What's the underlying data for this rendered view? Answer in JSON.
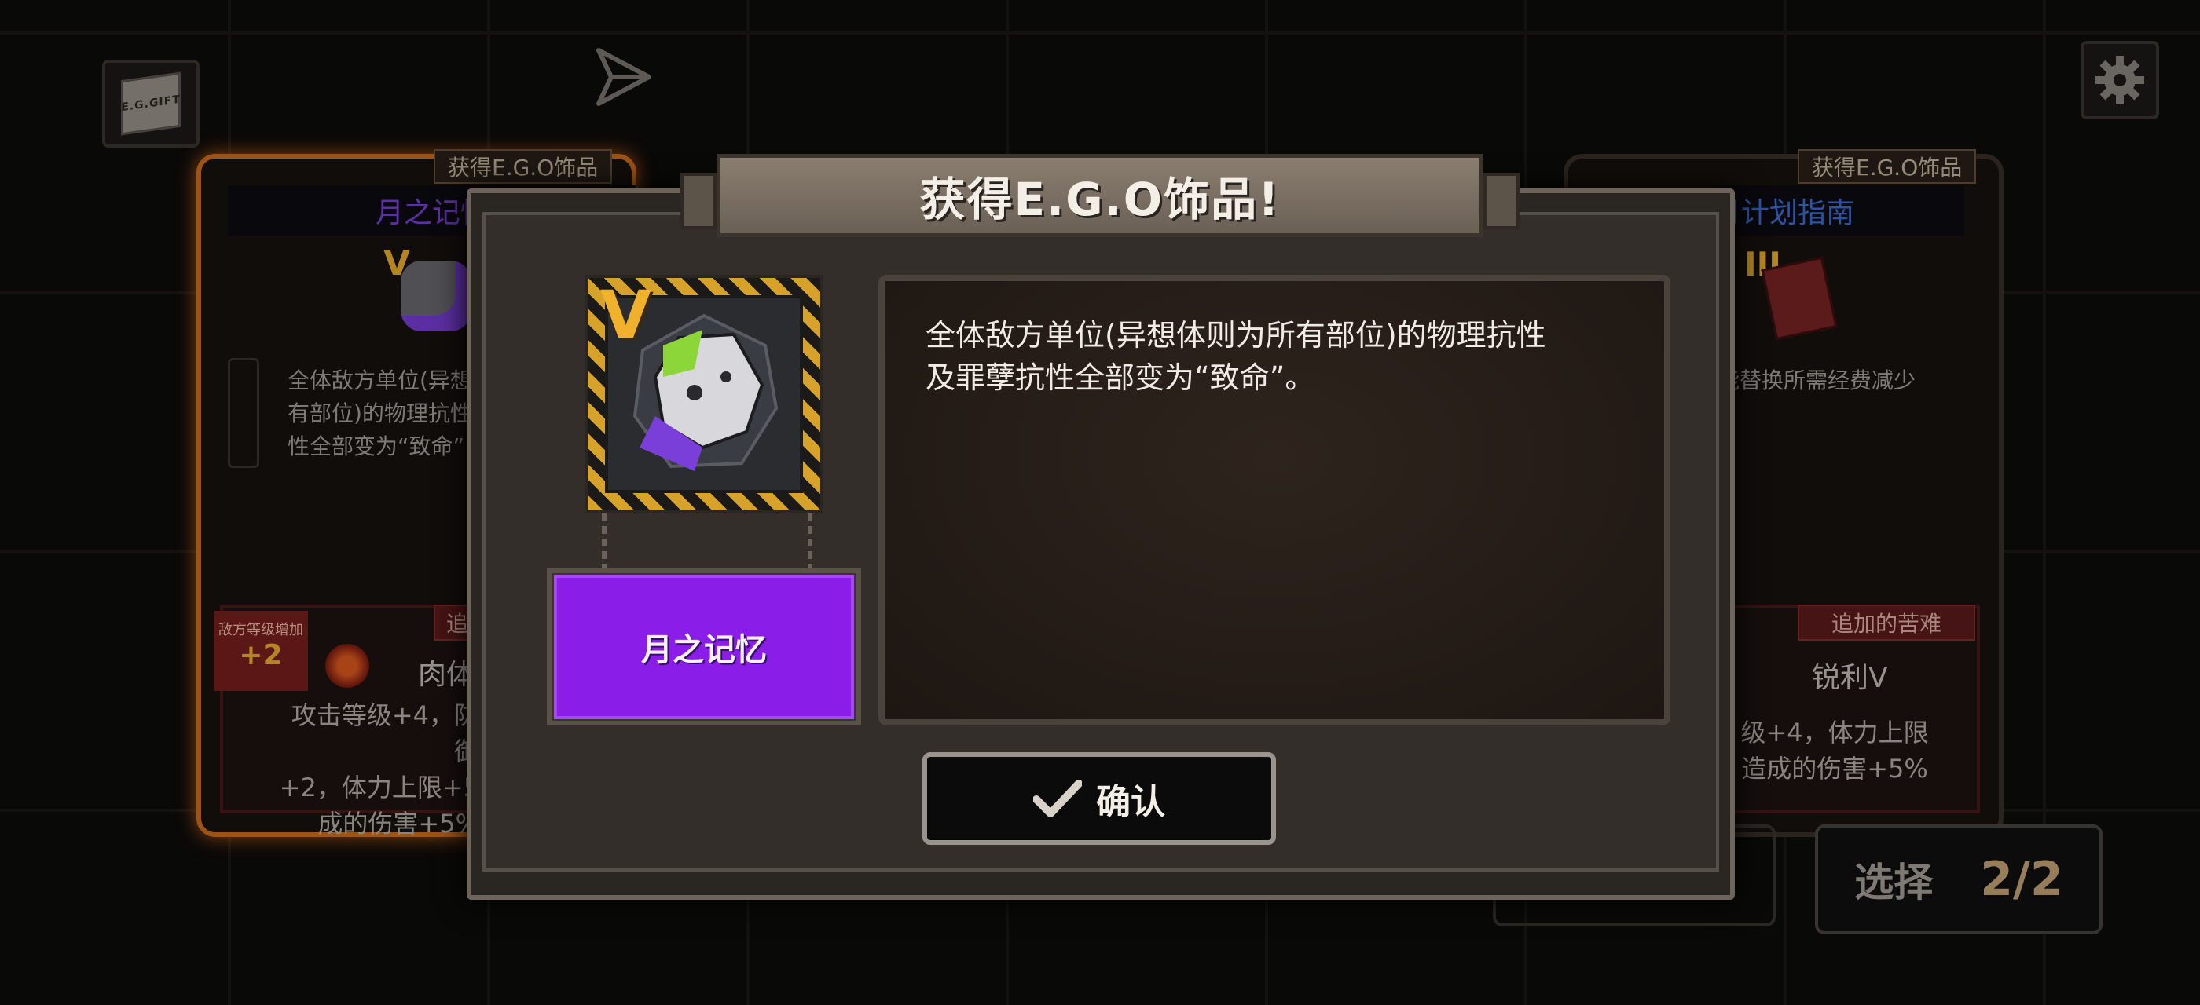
{
  "top_bar": {
    "gift_label": "E.G.GIFT",
    "send_icon": "send-icon",
    "settings_icon": "gear-icon"
  },
  "left_card": {
    "tag": "获得E.G.O饰品",
    "title": "月之记忆",
    "tier": "V",
    "desc_lines": [
      "全体敌方单位(异想",
      "有部位)的物理抗性",
      "性全部变为“致命”"
    ],
    "enemy_level_label": "敌方等级增加",
    "enemy_level_value": "+2",
    "penalty_tag": "追",
    "penalty_name": "肉体",
    "penalty_lines": [
      "攻击等级+4，防御",
      "+2，体力上限+5",
      "成的伤害+5%"
    ]
  },
  "right_card": {
    "tag": "获得E.G.O饰品",
    "title": "月计划指南",
    "tier": "III",
    "desc_lines": [
      "能替换所需经费减少"
    ],
    "penalty_tag": "追加的苦难",
    "penalty_name": "锐利V",
    "penalty_lines": [
      "级+4，体力上限",
      "造成的伤害+5%"
    ]
  },
  "select_button": {
    "label": "选择",
    "count": "2/2"
  },
  "modal": {
    "title": "获得E.G.O饰品!",
    "gift_tier": "V",
    "gift_name": "月之记忆",
    "description_lines": [
      "全体敌方单位(异想体则为所有部位)的物理抗性",
      "及罪孽抗性全部变为“致命”。"
    ],
    "confirm_label": "确认",
    "check_icon": "check-icon"
  },
  "colors": {
    "selected_card_border": "#d0701e",
    "gift_name_plate": "#8a1ee8",
    "tier_badge": "#f0b22c",
    "penalty_red": "#7a1e1e"
  }
}
